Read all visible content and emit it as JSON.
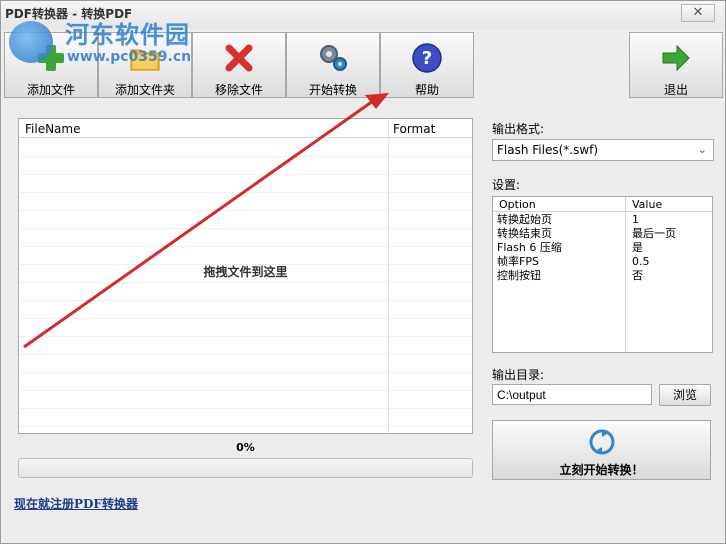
{
  "window": {
    "title": "PDF转换器 - 转换PDF",
    "close_glyph": "✕"
  },
  "watermark": {
    "title": "河东软件园",
    "url": "www.pc0359.cn"
  },
  "toolbar": {
    "add_file": "添加文件",
    "add_folder": "添加文件夹",
    "remove_file": "移除文件",
    "start_convert": "开始转换",
    "help": "帮助",
    "exit": "退出"
  },
  "file_list": {
    "col_filename": "FileName",
    "col_format": "Format",
    "drop_hint": "拖拽文件到这里"
  },
  "progress": {
    "text": "0%",
    "value": 0
  },
  "register_link": "现在就注册PDF转换器",
  "output_format": {
    "label": "输出格式:",
    "selected": "Flash Files(*.swf)"
  },
  "settings": {
    "label": "设置:",
    "col_option": "Option",
    "col_value": "Value",
    "rows": [
      {
        "option": "转换起始页",
        "value": "1"
      },
      {
        "option": "转换结束页",
        "value": "最后一页"
      },
      {
        "option": "Flash 6 压缩",
        "value": "是"
      },
      {
        "option": "帧率FPS",
        "value": "0.5"
      },
      {
        "option": "控制按钮",
        "value": "否"
      }
    ]
  },
  "output_dir": {
    "label": "输出目录:",
    "value": "C:\\output",
    "browse": "浏览"
  },
  "start_now": "立刻开始转换！",
  "colors": {
    "annotation_arrow": "#d42a2a",
    "link": "#1c3e8a",
    "accent_blue": "#2a7fd0"
  }
}
